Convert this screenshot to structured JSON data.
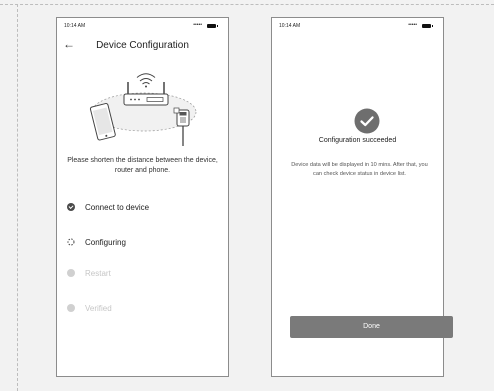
{
  "status_bar": {
    "time": "10:14 AM",
    "signal": "•••••"
  },
  "config_screen": {
    "back_icon": "arrow-left-icon",
    "title": "Device Configuration",
    "illustration": "router-phone-plug-illustration",
    "hint": "Please shorten the distance between the device, router and phone.",
    "steps": [
      {
        "label": "Connect to device",
        "state": "done",
        "icon": "check-circle-icon"
      },
      {
        "label": "Configuring",
        "state": "active",
        "icon": "spinner-icon"
      },
      {
        "label": "Restart",
        "state": "pending",
        "icon": "dot-icon"
      },
      {
        "label": "Verified",
        "state": "pending",
        "icon": "dot-icon"
      }
    ]
  },
  "success_screen": {
    "icon": "check-circle-icon",
    "title": "Configuration succeeded",
    "description": "Device data will be displayed in 10 mins. After that, you can check device status in device list.",
    "done_label": "Done"
  },
  "colors": {
    "done_dot": "#4a4a4a",
    "pending": "#d0d0d0",
    "button": "#7a7a7a",
    "success_icon": "#6e6e6e"
  }
}
